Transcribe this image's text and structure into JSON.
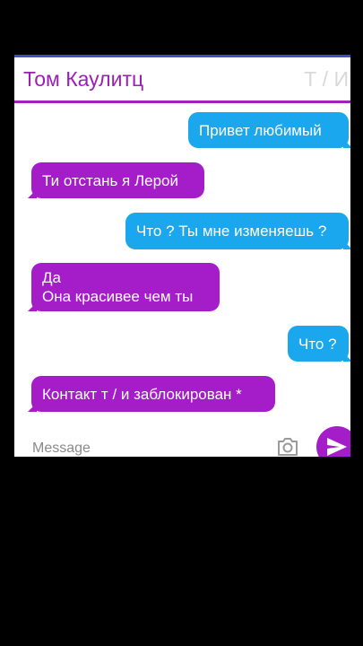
{
  "header": {
    "contact_name": "Том Каулитц",
    "right_label": "Т / И",
    "accent_color": "#9c1fb5"
  },
  "messages": [
    {
      "side": "out",
      "lines": [
        "Привет любимый"
      ]
    },
    {
      "side": "in",
      "lines": [
        "Ти отстань я Лерой"
      ]
    },
    {
      "side": "out",
      "lines": [
        "Что ? Ты мне изменяешь ?"
      ]
    },
    {
      "side": "in",
      "lines": [
        "Да",
        "Она красивее чем ты"
      ]
    },
    {
      "side": "out",
      "lines": [
        "Что ?"
      ]
    },
    {
      "side": "in",
      "lines": [
        "Контакт т / и заблокирован *"
      ]
    }
  ],
  "composer": {
    "placeholder": "Message",
    "camera_icon": "camera-icon",
    "send_icon": "send-icon"
  },
  "colors": {
    "outgoing_bubble": "#1aa7ee",
    "incoming_bubble": "#a51cc9",
    "send_button": "#a51cc9"
  }
}
